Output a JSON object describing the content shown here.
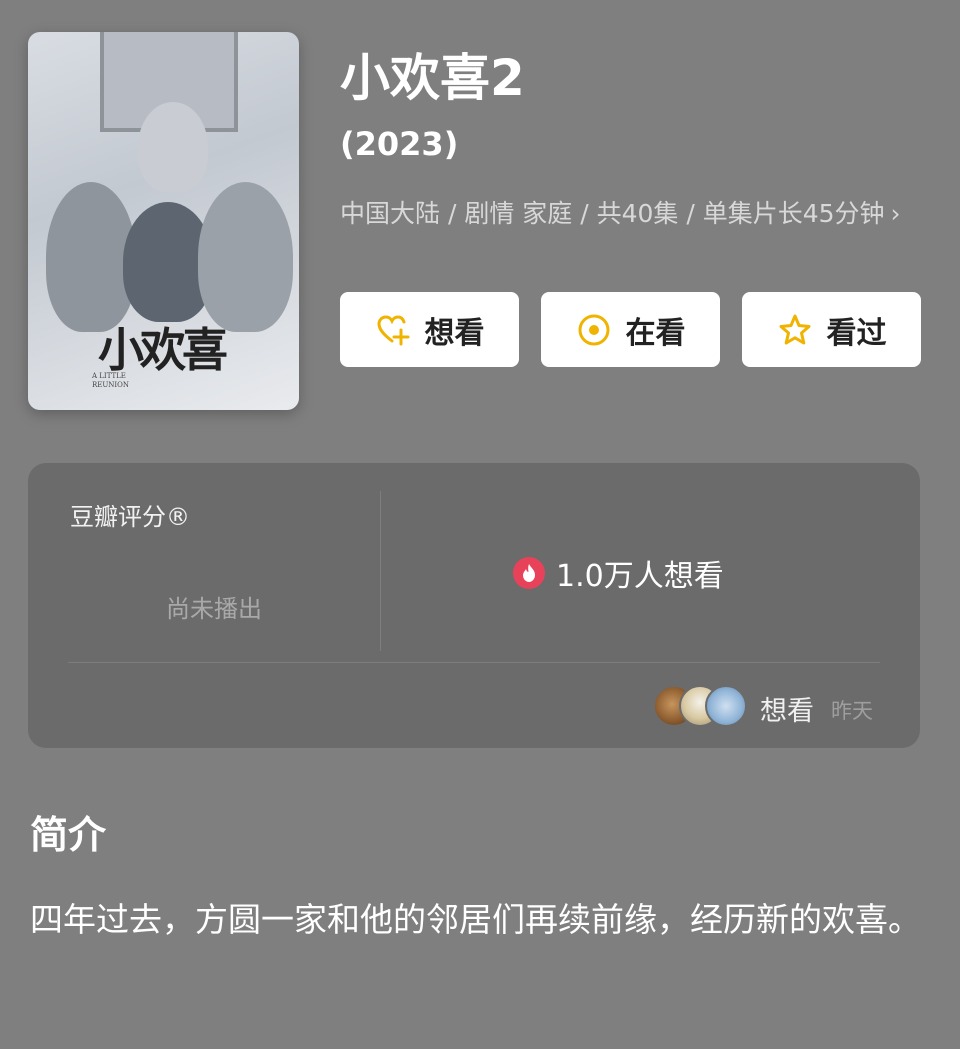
{
  "poster": {
    "logo_text": "小欢喜",
    "subtitle_lines": [
      "A LITTLE",
      "REUNION"
    ]
  },
  "show": {
    "title": "小欢喜2",
    "year": "(2023)",
    "meta": "中国大陆 / 剧情 家庭 / 共40集 / 单集片长45分钟",
    "meta_chevron": "›"
  },
  "actions": [
    {
      "label": "想看",
      "icon": "heart-plus-icon"
    },
    {
      "label": "在看",
      "icon": "target-icon"
    },
    {
      "label": "看过",
      "icon": "star-icon"
    }
  ],
  "rating": {
    "label": "豆瓣评分®",
    "status": "尚未播出",
    "want_count": "1.0万人想看",
    "activity_action": "想看",
    "activity_time": "昨天"
  },
  "intro": {
    "title": "简介",
    "text": "四年过去，方圆一家和他的邻居们再续前缘，经历新的欢喜。"
  },
  "colors": {
    "background": "#7f7f7f",
    "card": "#6b6b6b",
    "accent": "#f0b400",
    "fire": "#e8425a"
  }
}
